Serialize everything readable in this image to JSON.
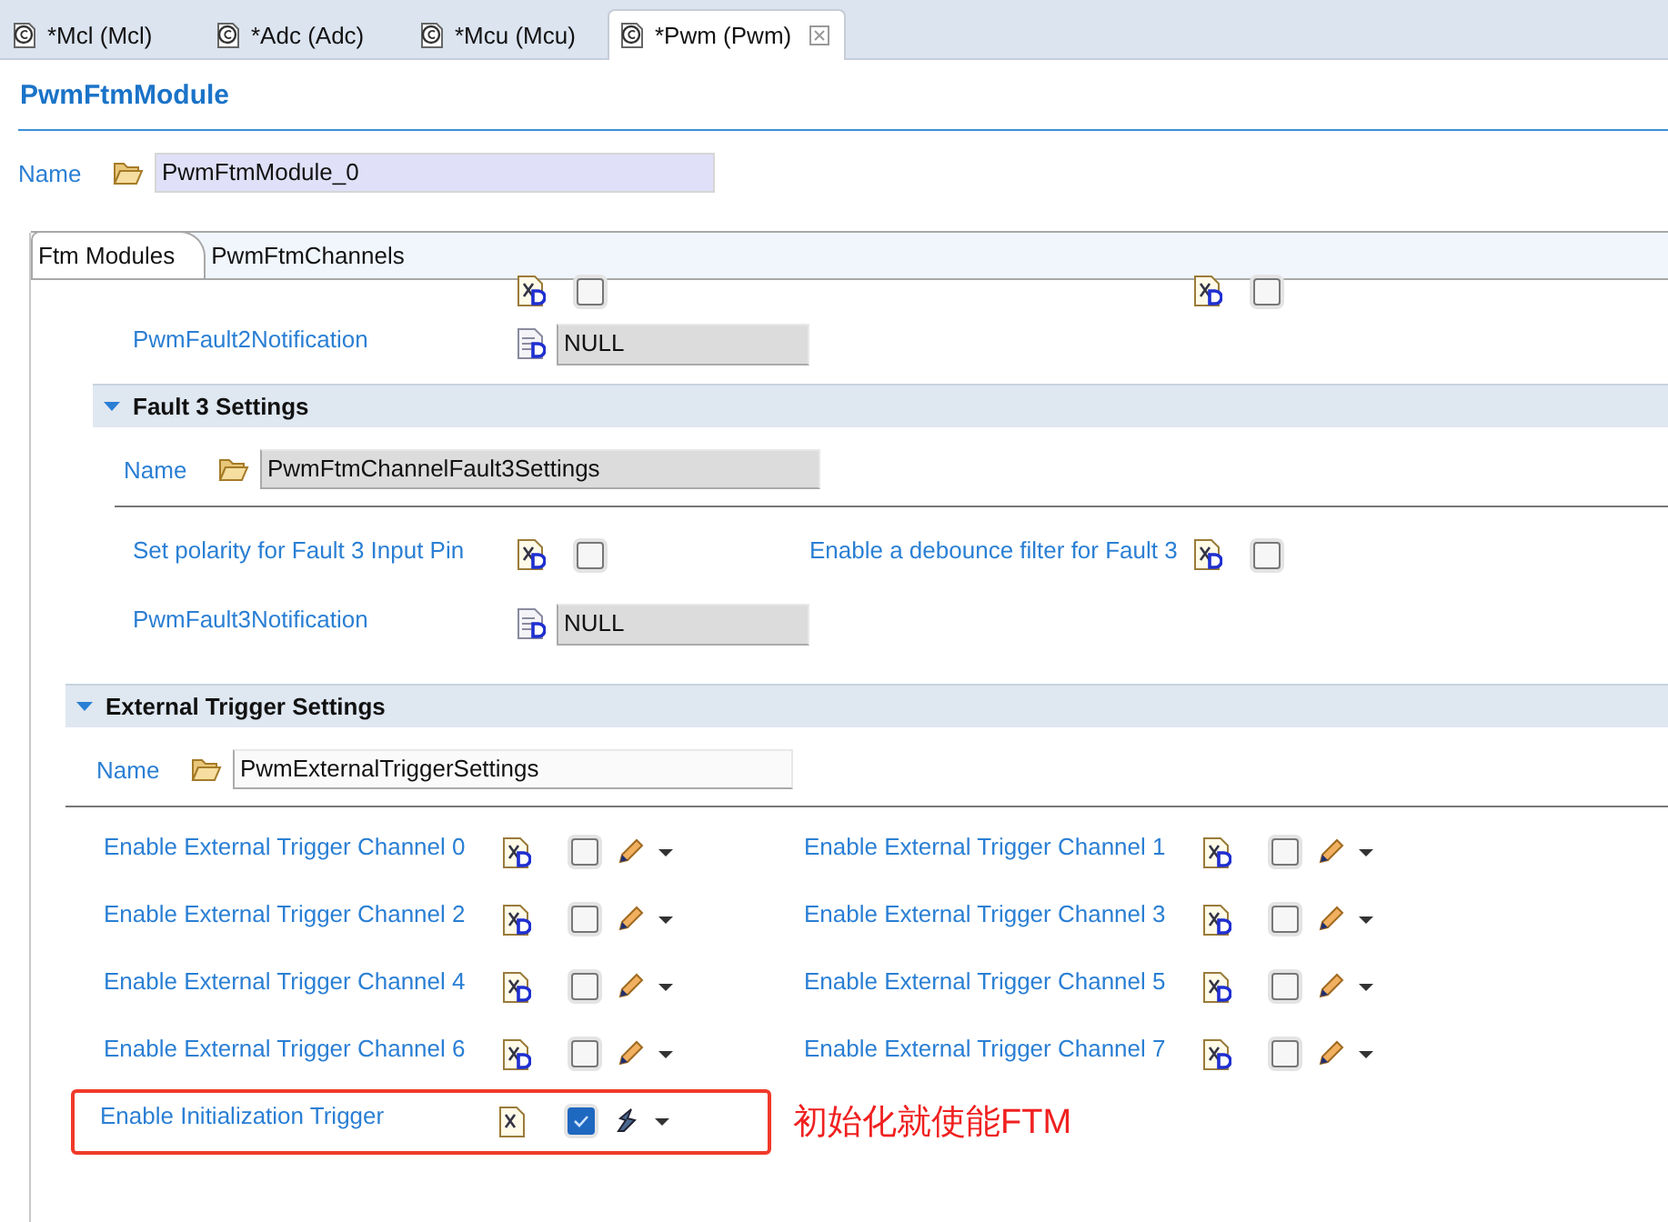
{
  "editor_tabs": [
    {
      "label": "*Mcl (Mcl)",
      "selected": false
    },
    {
      "label": "*Adc (Adc)",
      "selected": false
    },
    {
      "label": "*Mcu (Mcu)",
      "selected": false
    },
    {
      "label": "*Pwm (Pwm)",
      "selected": true
    }
  ],
  "title": "PwmFtmModule",
  "name": {
    "label": "Name",
    "value": "PwmFtmModule_0"
  },
  "inner_tabs": [
    {
      "label": "Ftm Modules",
      "selected": true
    },
    {
      "label": "PwmFtmChannels",
      "selected": false
    }
  ],
  "sections": [
    {
      "rows": [
        {
          "items": [
            {
              "kind": "check",
              "checked": false
            },
            {
              "kind": "check",
              "checked": false
            }
          ]
        },
        {
          "items": [
            {
              "kind": "text",
              "label": "PwmFault2Notification",
              "value": "NULL"
            }
          ]
        }
      ]
    },
    {
      "title": "Fault 3 Settings",
      "expanded": true,
      "name": {
        "label": "Name",
        "value": "PwmFtmChannelFault3Settings"
      },
      "rows": [
        {
          "items": [
            {
              "kind": "check",
              "label": "Set polarity for Fault 3 Input Pin",
              "checked": false
            },
            {
              "kind": "check",
              "label": "Enable a debounce filter for Fault 3",
              "checked": false
            }
          ]
        },
        {
          "items": [
            {
              "kind": "text",
              "label": "PwmFault3Notification",
              "value": "NULL"
            }
          ]
        }
      ]
    },
    {
      "title": "External Trigger Settings",
      "expanded": true,
      "name": {
        "label": "Name",
        "value": "PwmExternalTriggerSettings"
      },
      "rows": [
        {
          "items": [
            {
              "kind": "check_edit",
              "label": "Enable External Trigger Channel 0",
              "checked": false
            },
            {
              "kind": "check_edit",
              "label": "Enable External Trigger Channel 1",
              "checked": false
            }
          ]
        },
        {
          "items": [
            {
              "kind": "check_edit",
              "label": "Enable External Trigger Channel 2",
              "checked": false
            },
            {
              "kind": "check_edit",
              "label": "Enable External Trigger Channel 3",
              "checked": false
            }
          ]
        },
        {
          "items": [
            {
              "kind": "check_edit",
              "label": "Enable External Trigger Channel 4",
              "checked": false
            },
            {
              "kind": "check_edit",
              "label": "Enable External Trigger Channel 5",
              "checked": false
            }
          ]
        },
        {
          "items": [
            {
              "kind": "check_edit",
              "label": "Enable External Trigger Channel 6",
              "checked": false
            },
            {
              "kind": "check_edit",
              "label": "Enable External Trigger Channel 7",
              "checked": false
            }
          ]
        },
        {
          "items": [
            {
              "kind": "check_calc",
              "label": "Enable Initialization Trigger",
              "checked": true,
              "highlighted": true
            }
          ],
          "note": "初始化就使能FTM"
        }
      ]
    }
  ]
}
